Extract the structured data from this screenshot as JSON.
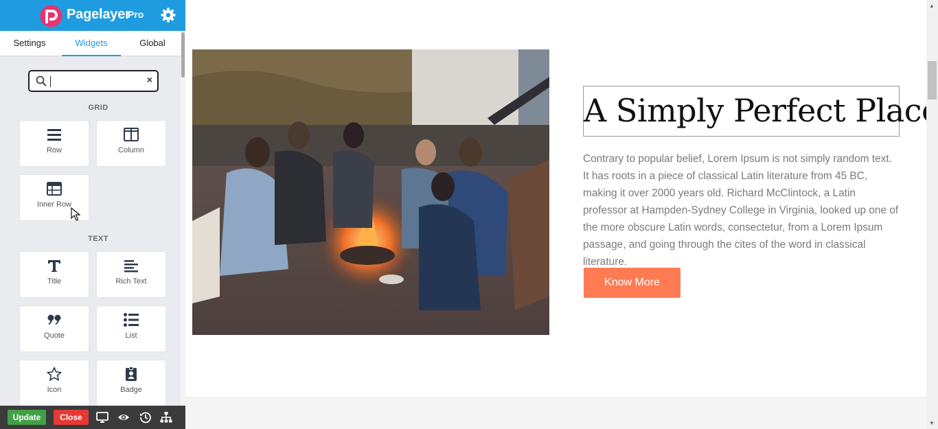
{
  "app": {
    "brand": "Pagelayer",
    "brand_suffix": "Pro",
    "colors": {
      "header": "#1f9ce0",
      "active_tab": "#1f9ce0",
      "update": "#43a047",
      "close": "#e53935",
      "cta": "#ff7b54"
    }
  },
  "sidebar": {
    "tabs": [
      {
        "label": "Settings",
        "active": false
      },
      {
        "label": "Widgets",
        "active": true
      },
      {
        "label": "Global",
        "active": false
      }
    ],
    "search": {
      "value": "",
      "placeholder": ""
    },
    "groups": [
      {
        "title": "GRID",
        "widgets": [
          {
            "label": "Row",
            "icon": "row-icon"
          },
          {
            "label": "Column",
            "icon": "column-icon"
          },
          {
            "label": "Inner Row",
            "icon": "inner-row-icon"
          }
        ]
      },
      {
        "title": "TEXT",
        "widgets": [
          {
            "label": "Title",
            "icon": "title-icon"
          },
          {
            "label": "Rich Text",
            "icon": "rich-text-icon"
          },
          {
            "label": "Quote",
            "icon": "quote-icon"
          },
          {
            "label": "List",
            "icon": "list-icon"
          },
          {
            "label": "Icon",
            "icon": "star-icon"
          },
          {
            "label": "Badge",
            "icon": "badge-icon"
          }
        ]
      }
    ],
    "bottom": {
      "update_label": "Update",
      "close_label": "Close",
      "icons": [
        "desktop-icon",
        "eye-icon",
        "history-icon",
        "sitemap-icon"
      ]
    }
  },
  "page": {
    "heading": "A Simply Perfect Place",
    "body": "Contrary to popular belief, Lorem Ipsum is not simply random text. It has roots in a piece of classical Latin literature from 45 BC, making it over 2000 years old. Richard McClintock, a Latin professor at Hampden-Sydney College in Virginia, looked up one of the more obscure Latin words, consectetur, from a Lorem Ipsum passage, and going through the cites of the word in classical literature.",
    "button": "Know More",
    "photo": "people-around-campfire-photo"
  }
}
